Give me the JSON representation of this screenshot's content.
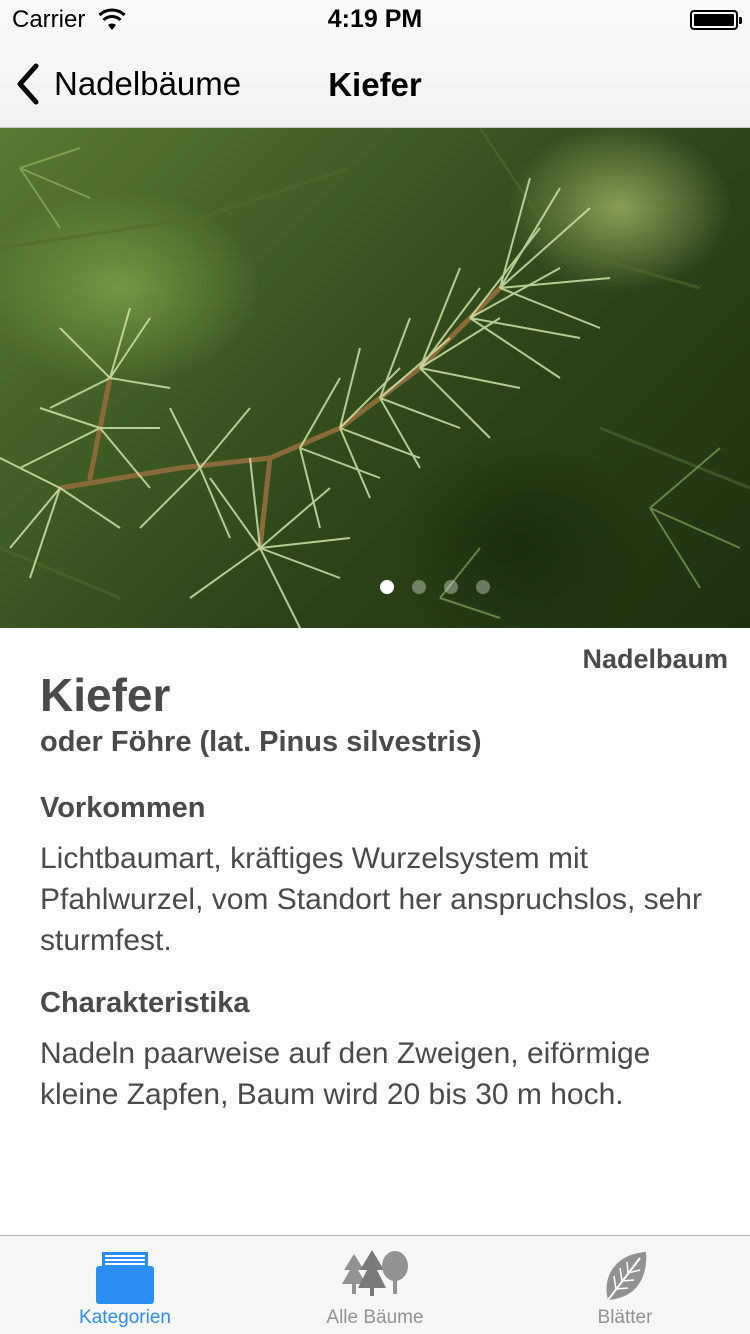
{
  "status_bar": {
    "carrier": "Carrier",
    "time": "4:19 PM"
  },
  "nav": {
    "back_label": "Nadelbäume",
    "title": "Kiefer"
  },
  "gallery": {
    "page_count": 4,
    "current_page": 1
  },
  "tree": {
    "category": "Nadelbaum",
    "name": "Kiefer",
    "subtitle": "oder Föhre (lat. Pinus silvestris)",
    "sections": [
      {
        "heading": "Vorkommen",
        "text": "Lichtbaumart, kräftiges Wurzelsystem mit Pfahlwurzel, vom Standort her anspruchslos, sehr sturmfest."
      },
      {
        "heading": "Charakteristika",
        "text": "Nadeln paarweise auf den Zweigen, eiförmige kleine Zapfen, Baum wird 20 bis 30 m hoch."
      }
    ]
  },
  "tabbar": {
    "tabs": [
      {
        "label": "Kategorien",
        "icon": "box-icon",
        "active": true
      },
      {
        "label": "Alle Bäume",
        "icon": "trees-icon",
        "active": false
      },
      {
        "label": "Blätter",
        "icon": "leaf-icon",
        "active": false
      }
    ],
    "active_color": "#2a8ef2",
    "inactive_color": "#929292"
  }
}
